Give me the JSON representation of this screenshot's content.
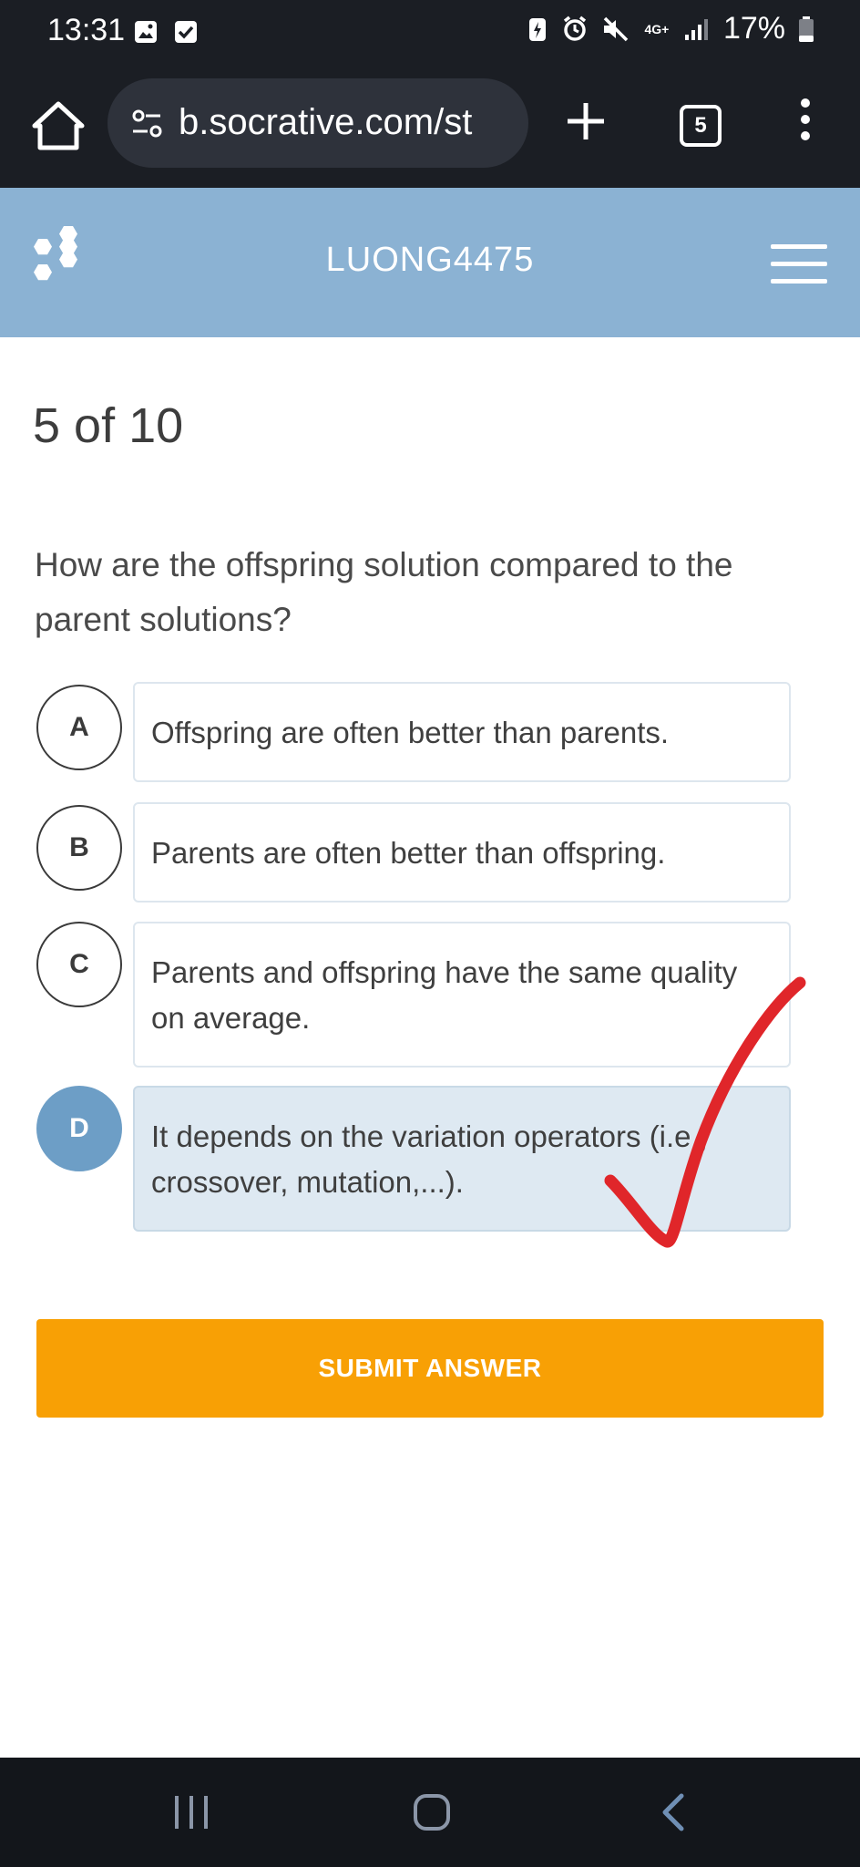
{
  "status_bar": {
    "time": "13:31",
    "network": "4G+",
    "battery": "17%"
  },
  "browser": {
    "url": "b.socrative.com/st",
    "tab_count": "5"
  },
  "header": {
    "room_name": "LUONG4475"
  },
  "quiz": {
    "progress": "5 of 10",
    "question": "How are the offspring solution compared to the parent solutions?",
    "options": [
      {
        "letter": "A",
        "text": "Offspring are often better than parents."
      },
      {
        "letter": "B",
        "text": "Parents are often better than offspring."
      },
      {
        "letter": "C",
        "text": "Parents and offspring have the same quality on average."
      },
      {
        "letter": "D",
        "text": "It depends on the variation operators (i.e., crossover, mutation,...)."
      }
    ],
    "selected": "D",
    "submit_label": "SUBMIT ANSWER"
  },
  "colors": {
    "header_bg": "#8bb2d3",
    "selected_circle": "#6d9ec6",
    "selected_box": "#dee9f2",
    "submit_bg": "#f8a005",
    "checkmark": "#e0262a"
  },
  "icons": {
    "status": [
      "gallery-icon",
      "check-box-icon",
      "battery-saver-icon",
      "alarm-icon",
      "mute-icon",
      "signal-icon",
      "battery-icon"
    ],
    "toolbar": [
      "home-icon",
      "site-info-icon",
      "new-tab-icon",
      "tabs-icon",
      "more-menu-icon"
    ],
    "nav": [
      "recent-apps-icon",
      "home-nav-icon",
      "back-icon"
    ]
  }
}
